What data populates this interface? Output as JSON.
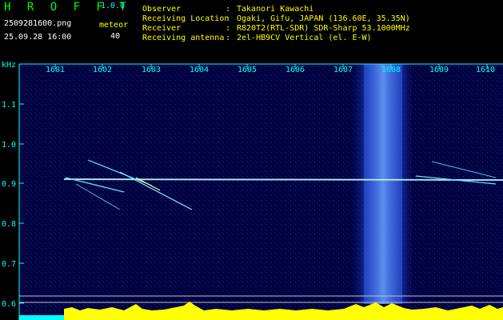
{
  "header": {
    "app_title": "H R O F F T",
    "version": "1.0.0",
    "filename": "2509281600.png",
    "timestamp": "25.09.28 16:00",
    "counter_label": "meteor",
    "counter_value": "40",
    "observer_label": "Observer",
    "observer_value": "Takanori Kawachi",
    "location_label": "Receiving Location",
    "location_value": "Ogaki, Gifu, JAPAN (136.60E, 35.35N)",
    "receiver_label": "Receiver",
    "receiver_value": "R820T2(RTL-SDR) SDR-Sharp 53.1000MHz",
    "antenna_label": "Receiving antenna",
    "antenna_value": "2el-HB9CV Vertical (el. E-W)",
    "separator": ":"
  },
  "spectrogram": {
    "y_unit": "kHz",
    "y_ticks": [
      "1.1",
      "1.0",
      "0.9",
      "0.8",
      "0.7",
      "0.6"
    ],
    "x_ticks": [
      "1601",
      "1602",
      "1603",
      "1604",
      "1605",
      "1606",
      "1607",
      "1608",
      "1609",
      "1610"
    ],
    "colors": {
      "background": "#00003a",
      "noise_band": "#3050ff",
      "signal": "#ffff00",
      "axis": "#00ffff",
      "hist_base": "#00ffff"
    }
  }
}
